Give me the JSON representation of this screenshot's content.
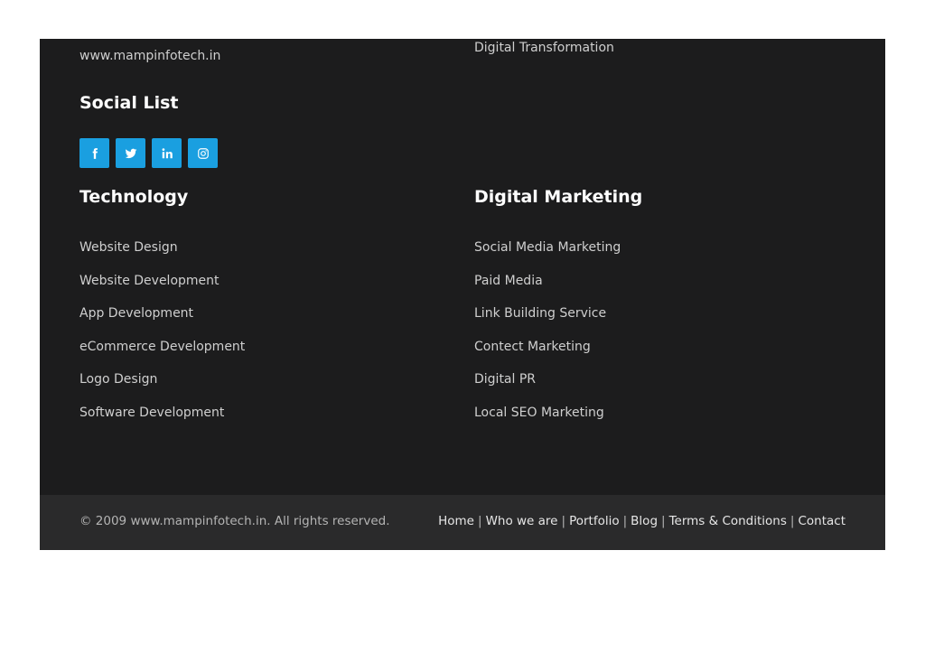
{
  "contact": {
    "website": "www.mampinfotech.in"
  },
  "services_top": {
    "digital_transformation": "Digital Transformation"
  },
  "social": {
    "heading": "Social List",
    "items": [
      {
        "name": "facebook",
        "icon": "facebook-icon"
      },
      {
        "name": "twitter",
        "icon": "twitter-icon"
      },
      {
        "name": "linkedin",
        "icon": "linkedin-icon"
      },
      {
        "name": "instagram",
        "icon": "instagram-icon"
      }
    ],
    "button_color": "#1a9fe0"
  },
  "technology": {
    "heading": "Technology",
    "links": [
      "Website Design",
      "Website Development",
      "App Development",
      "eCommerce Development",
      "Logo Design",
      "Software Development"
    ]
  },
  "digital_marketing": {
    "heading": "Digital Marketing",
    "links": [
      "Social Media Marketing",
      "Paid Media",
      "Link Building Service",
      "Contect Marketing",
      "Digital PR",
      "Local SEO Marketing"
    ]
  },
  "bottom_bar": {
    "copyright": "© 2009 www.mampinfotech.in. All rights reserved.",
    "nav": [
      "Home",
      "Who we are",
      "Portfolio",
      "Blog",
      "Terms & Conditions",
      "Contact"
    ],
    "separator": "|"
  },
  "colors": {
    "footer_bg": "#1c1c1d",
    "bottom_bar_bg": "#2a2a2b",
    "link_text": "#cfcfcf",
    "heading_text": "#ffffff"
  }
}
